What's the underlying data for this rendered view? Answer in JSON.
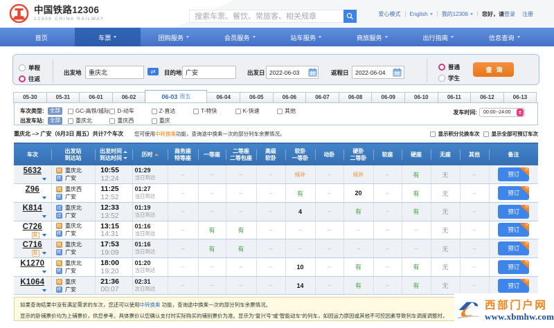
{
  "colors": {
    "brand_red": "#e8472b",
    "nav_blue": "#4c82d4",
    "nav_active_blue": "#2e62b2",
    "accent_blue": "#3c7ee0",
    "link_blue": "#4272bd",
    "button_orange": "#f0730a",
    "status_green": "#2fa54b",
    "status_orange": "#f8890a",
    "radio_pink": "#e0447e",
    "table_header_blue": "#3a76c2"
  },
  "topbar": {
    "logo_title": "中国铁路12306",
    "logo_subtitle": "12306 CHINA RAILWAY",
    "search_placeholder": "搜索车票、餐饮、常旅客、相关规章",
    "care_mode": "爱心模式",
    "language": "English",
    "my_12306": "我的12306",
    "greeting": "您好，请",
    "login": "登录",
    "register": "注册"
  },
  "nav": {
    "items": [
      {
        "label": "首页",
        "active": false,
        "dropdown": false
      },
      {
        "label": "车票",
        "active": true,
        "dropdown": true
      },
      {
        "label": "团购服务",
        "active": false,
        "dropdown": true
      },
      {
        "label": "会员服务",
        "active": false,
        "dropdown": true
      },
      {
        "label": "站车服务",
        "active": false,
        "dropdown": true
      },
      {
        "label": "商旅服务",
        "active": false,
        "dropdown": true
      },
      {
        "label": "出行指南",
        "active": false,
        "dropdown": true
      },
      {
        "label": "信息查询",
        "active": false,
        "dropdown": true
      }
    ]
  },
  "search_form": {
    "trip_one_way": "单程",
    "trip_round": "往返",
    "trip_selected": "往返",
    "from_label": "出发地",
    "from_value": "重庆北",
    "to_label": "目的地",
    "to_value": "广安",
    "depart_label": "出发日",
    "depart_value": "2022-06-03",
    "return_label": "返程日",
    "return_value": "2022-06-04",
    "pass_normal": "普通",
    "pass_student": "学生",
    "pass_selected": "普通",
    "submit_label": "查询",
    "swap_icon": "⇄"
  },
  "date_tabs": {
    "tabs": [
      {
        "label": "05-30"
      },
      {
        "label": "05-31"
      },
      {
        "label": "06-01"
      },
      {
        "label": "06-02"
      },
      {
        "label": "06-03",
        "weekday": "周五",
        "active": true
      },
      {
        "label": "06-04"
      },
      {
        "label": "06-05"
      },
      {
        "label": "06-06"
      },
      {
        "label": "06-07"
      },
      {
        "label": "06-08"
      },
      {
        "label": "06-09"
      },
      {
        "label": "06-10"
      },
      {
        "label": "06-11"
      },
      {
        "label": "06-12"
      },
      {
        "label": "06-13"
      }
    ]
  },
  "filters": {
    "train_type_label": "车次类型:",
    "train_type_all": "全部",
    "train_type_options": [
      "GC-高铁/城际",
      "D-动车",
      "Z-直达",
      "T-特快",
      "K-快速",
      "其他"
    ],
    "station_label": "出发车站:",
    "station_all": "全部",
    "station_options": [
      "重庆北",
      "重庆西",
      "重庆"
    ],
    "depart_time_label": "发车时间:",
    "depart_time_value": "00:00--24:00"
  },
  "summary": {
    "route": "重庆北 --> 广安（6月3日 周五）共计7个车次",
    "tip_prefix": "您可使用",
    "tip_link": "中转换乘",
    "tip_suffix": "功能，查询途中换乘一次的部分列车余票情况。",
    "toggle_points": "显示积分兑换车次",
    "toggle_bookable": "显示全部可预订车次"
  },
  "table": {
    "headers": [
      {
        "lines": [
          "车次"
        ]
      },
      {
        "lines": [
          "出发站",
          "到达站"
        ]
      },
      {
        "lines": [
          "出发时间",
          "到达时间"
        ],
        "sorts": [
          "up",
          "dn"
        ]
      },
      {
        "lines": [
          "历时"
        ],
        "sorts": [
          "up-hot"
        ]
      },
      {
        "lines": [
          "商务座",
          "特等座"
        ]
      },
      {
        "lines": [
          "一等座"
        ]
      },
      {
        "lines": [
          "二等座",
          "二等包座"
        ]
      },
      {
        "lines": [
          "高级",
          "软卧"
        ]
      },
      {
        "lines": [
          "软卧",
          "一等卧"
        ]
      },
      {
        "lines": [
          "动卧"
        ]
      },
      {
        "lines": [
          "硬卧",
          "二等卧"
        ]
      },
      {
        "lines": [
          "软座"
        ]
      },
      {
        "lines": [
          "硬座"
        ]
      },
      {
        "lines": [
          "无座"
        ]
      },
      {
        "lines": [
          "其他"
        ]
      },
      {
        "lines": [
          "备注"
        ]
      }
    ],
    "fuxing_badge": "复",
    "book_label": "预订",
    "ribbon_glyph": "兑",
    "rows": [
      {
        "train": "5632",
        "fuxing": false,
        "from": "重庆北",
        "to": "广安",
        "depart": "10:55",
        "arrive": "12:24",
        "duration": "01:29",
        "arrive_day": "当日到达",
        "seats": [
          "--",
          "--",
          "--",
          "--",
          "候补",
          "--",
          "候补",
          "--",
          "有",
          "无",
          "--"
        ],
        "from_icon": "始",
        "to_icon": "终"
      },
      {
        "train": "Z96",
        "fuxing": false,
        "from": "重庆西",
        "to": "广安",
        "depart": "11:25",
        "arrive": "12:52",
        "duration": "01:27",
        "arrive_day": "当日到达",
        "seats": [
          "--",
          "--",
          "--",
          "--",
          "有",
          "--",
          "20",
          "--",
          "有",
          "无",
          "--"
        ],
        "from_icon": "始",
        "to_icon": "终"
      },
      {
        "train": "K814",
        "fuxing": false,
        "from": "重庆北",
        "to": "广安",
        "depart": "12:33",
        "arrive": "13:52",
        "duration": "01:19",
        "arrive_day": "当日到达",
        "seats": [
          "--",
          "--",
          "--",
          "--",
          "4",
          "--",
          "有",
          "--",
          "有",
          "无",
          "--"
        ],
        "from_icon": "过",
        "to_icon": "过"
      },
      {
        "train": "C726",
        "fuxing": true,
        "from": "重庆北",
        "to": "广安",
        "depart": "13:15",
        "arrive": "14:31",
        "duration": "01:16",
        "arrive_day": "当日到达",
        "seats": [
          "--",
          "有",
          "有",
          "--",
          "--",
          "--",
          "--",
          "--",
          "--",
          "无",
          "--"
        ],
        "from_icon": "始",
        "to_icon": "终"
      },
      {
        "train": "C716",
        "fuxing": true,
        "from": "重庆北",
        "to": "广安",
        "depart": "17:53",
        "arrive": "19:09",
        "duration": "01:16",
        "arrive_day": "当日到达",
        "seats": [
          "--",
          "有",
          "有",
          "--",
          "--",
          "--",
          "--",
          "--",
          "--",
          "无",
          "--"
        ],
        "from_icon": "始",
        "to_icon": "终"
      },
      {
        "train": "K1270",
        "fuxing": false,
        "from": "重庆北",
        "to": "广安",
        "depart": "18:00",
        "arrive": "19:20",
        "duration": "01:20",
        "arrive_day": "当日到达",
        "seats": [
          "--",
          "--",
          "--",
          "--",
          "10",
          "--",
          "有",
          "--",
          "有",
          "无",
          "--"
        ],
        "from_icon": "始",
        "to_icon": "终"
      },
      {
        "train": "K1064",
        "fuxing": false,
        "from": "重庆",
        "to": "广安",
        "depart": "21:36",
        "arrive": "00:07",
        "duration": "02:31",
        "arrive_day": "次日到达",
        "seats": [
          "--",
          "--",
          "--",
          "--",
          "14",
          "--",
          "有",
          "--",
          "有",
          "无",
          "--"
        ],
        "from_icon": "始",
        "to_icon": "终"
      }
    ]
  },
  "notes": {
    "line1_prefix": "如果查询结果中没有满足需求的车次，您还可以使用",
    "line1_link": "中转换乘",
    "line1_suffix": " 功能，查询途中换乘一次的部分列车余票情况。",
    "line2": "显示的卧铺票价均为上铺票价，供您参考。具体票价以您确认支付时实际购买的铺别票价为准。显示为“复兴号”或“智能动车”的列车，如因运力原因或其他不可控因素导致列车调度调整时，"
  },
  "watermark": {
    "site_name": "西部门户网",
    "site_url": "www.xbmhw.com"
  }
}
